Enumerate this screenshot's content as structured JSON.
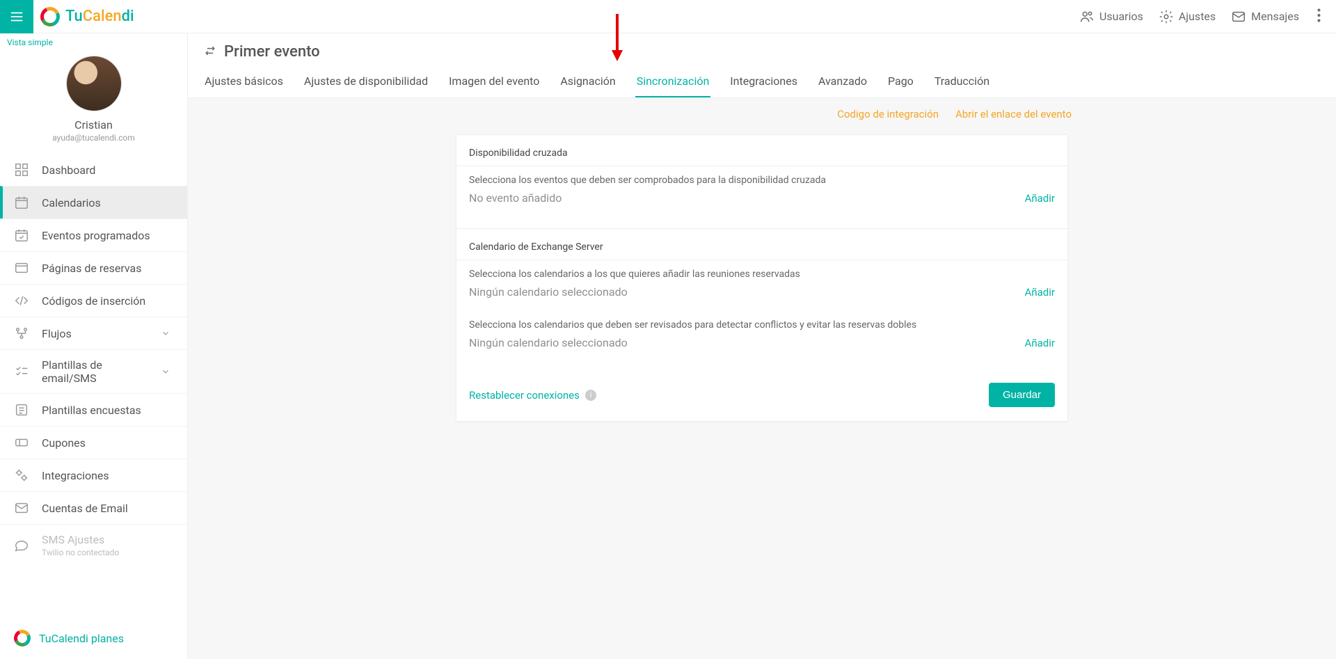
{
  "topbar": {
    "logo_tu": "Tu",
    "logo_calen": "Calen",
    "logo_di": "di",
    "users": "Usuarios",
    "settings": "Ajustes",
    "messages": "Mensajes"
  },
  "sidebar": {
    "vista_simple": "Vista simple",
    "profile_name": "Cristian",
    "profile_email": "ayuda@tucalendi.com",
    "items": {
      "dashboard": "Dashboard",
      "calendarios": "Calendarios",
      "eventos": "Eventos programados",
      "paginas": "Páginas de reservas",
      "codigos": "Códigos de inserción",
      "flujos": "Flujos",
      "plantillas_email": "Plantillas de email/SMS",
      "plantillas_enc": "Plantillas encuestas",
      "cupones": "Cupones",
      "integraciones": "Integraciones",
      "cuentas_email": "Cuentas de Email",
      "sms_ajustes": "SMS Ajustes",
      "sms_sub": "Twilio no contectado"
    },
    "planes": "TuCalendi planes"
  },
  "page": {
    "title": "Primer evento",
    "tabs": {
      "basicos": "Ajustes básicos",
      "disponibilidad": "Ajustes de disponibilidad",
      "imagen": "Imagen del evento",
      "asignacion": "Asignación",
      "sincronizacion": "Sincronización",
      "integraciones": "Integraciones",
      "avanzado": "Avanzado",
      "pago": "Pago",
      "traduccion": "Traducción"
    },
    "links": {
      "codigo": "Codigo de integración",
      "abrir": "Abrir el enlace del evento"
    },
    "section1": {
      "title": "Disponibilidad cruzada",
      "hint": "Selecciona los eventos que deben ser comprobados para la disponibilidad cruzada",
      "empty": "No evento añadido",
      "add": "Añadir"
    },
    "section2": {
      "title": "Calendario de Exchange Server",
      "hint1": "Selecciona los calendarios a los que quieres añadir las reuniones reservadas",
      "empty1": "Ningún calendario seleccionado",
      "add1": "Añadir",
      "hint2": "Selecciona los calendarios que deben ser revisados para detectar conflictos y evitar las reservas dobles",
      "empty2": "Ningún calendario seleccionado",
      "add2": "Añadir"
    },
    "footer": {
      "reset": "Restablecer conexiones",
      "save": "Guardar"
    }
  }
}
